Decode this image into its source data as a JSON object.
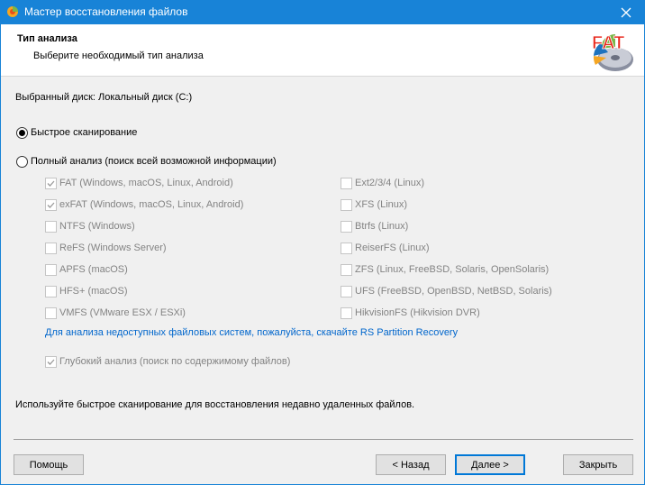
{
  "window": {
    "title": "Мастер восстановления файлов"
  },
  "header": {
    "title": "Тип анализа",
    "subtitle": "Выберите необходимый тип анализа",
    "logo_text": "FAT"
  },
  "selected_disk": "Выбранный диск: Локальный диск (C:)",
  "scan_options": {
    "quick": {
      "label": "Быстрое сканирование",
      "checked": true
    },
    "full": {
      "label": "Полный анализ (поиск всей возможной информации)",
      "checked": false
    }
  },
  "filesystems_left": [
    {
      "label": "FAT (Windows, macOS, Linux, Android)",
      "checked": true
    },
    {
      "label": "exFAT (Windows, macOS, Linux, Android)",
      "checked": true
    },
    {
      "label": "NTFS (Windows)",
      "checked": false
    },
    {
      "label": "ReFS (Windows Server)",
      "checked": false
    },
    {
      "label": "APFS (macOS)",
      "checked": false
    },
    {
      "label": "HFS+ (macOS)",
      "checked": false
    },
    {
      "label": "VMFS (VMware ESX / ESXi)",
      "checked": false
    }
  ],
  "filesystems_right": [
    {
      "label": "Ext2/3/4 (Linux)",
      "checked": false
    },
    {
      "label": "XFS (Linux)",
      "checked": false
    },
    {
      "label": "Btrfs (Linux)",
      "checked": false
    },
    {
      "label": "ReiserFS (Linux)",
      "checked": false
    },
    {
      "label": "ZFS (Linux, FreeBSD, Solaris, OpenSolaris)",
      "checked": false
    },
    {
      "label": "UFS (FreeBSD, OpenBSD, NetBSD, Solaris)",
      "checked": false
    },
    {
      "label": "HikvisionFS (Hikvision DVR)",
      "checked": false
    }
  ],
  "partition_link": "Для анализа недоступных файловых систем, пожалуйста, скачайте RS Partition Recovery",
  "deep_analysis": {
    "label": "Глубокий анализ (поиск по содержимому файлов)",
    "checked": true
  },
  "hint": "Используйте быстрое сканирование для восстановления недавно удаленных файлов.",
  "buttons": {
    "help": "Помощь",
    "back": "< Назад",
    "next": "Далее >",
    "close": "Закрыть"
  },
  "colors": {
    "titlebar": "#1883d7",
    "link": "#0066cc",
    "disabled_text": "#838383"
  }
}
